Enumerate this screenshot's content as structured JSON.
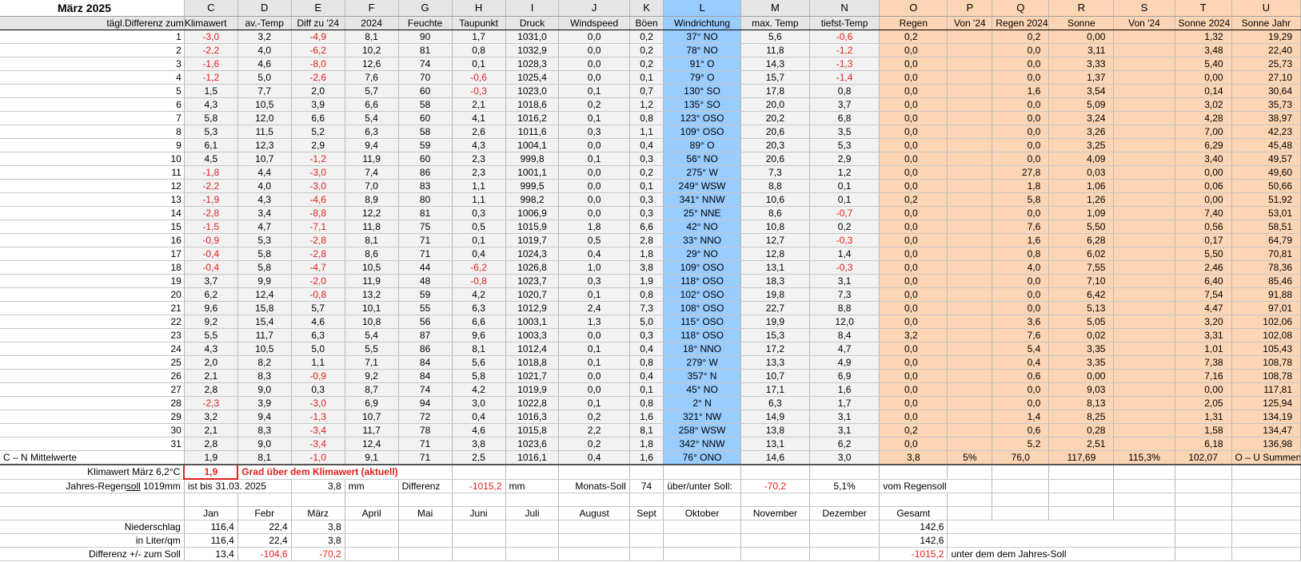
{
  "title": "März 2025",
  "columns": {
    "letters": [
      "C",
      "D",
      "E",
      "F",
      "G",
      "H",
      "I",
      "J",
      "K",
      "L",
      "M",
      "N",
      "O",
      "P",
      "Q",
      "R",
      "S",
      "T",
      "U"
    ],
    "subheader_lead": "tägl.Differenz zum",
    "names": [
      "Klimawert",
      "av.-Temp",
      "Diff zu '24",
      "2024",
      "Feuchte",
      "Taupunkt",
      "Druck",
      "Windspeed",
      "Böen",
      "Windrichtung",
      "max. Temp",
      "tiefst-Temp",
      "Regen",
      "Von '24",
      "Regen 2024",
      "Sonne",
      "Von '24",
      "Sonne 2024",
      "Sonne Jahr"
    ]
  },
  "rows": [
    [
      "1",
      "-3,0",
      "3,2",
      "-4,9",
      "8,1",
      "90",
      "1,7",
      "1031,0",
      "0,0",
      "0,2",
      "37° NO",
      "5,6",
      "-0,6",
      "0,2",
      "",
      "0,2",
      "0,00",
      "",
      "1,32",
      "19,29"
    ],
    [
      "2",
      "-2,2",
      "4,0",
      "-6,2",
      "10,2",
      "81",
      "0,8",
      "1032,9",
      "0,0",
      "0,2",
      "78° NO",
      "11,8",
      "-1,2",
      "0,0",
      "",
      "0,0",
      "3,11",
      "",
      "3,48",
      "22,40"
    ],
    [
      "3",
      "-1,6",
      "4,6",
      "-8,0",
      "12,6",
      "74",
      "0,1",
      "1028,3",
      "0,0",
      "0,2",
      "91° O",
      "14,3",
      "-1,3",
      "0,0",
      "",
      "0,0",
      "3,33",
      "",
      "5,40",
      "25,73"
    ],
    [
      "4",
      "-1,2",
      "5,0",
      "-2,6",
      "7,6",
      "70",
      "-0,6",
      "1025,4",
      "0,0",
      "0,1",
      "79° O",
      "15,7",
      "-1,4",
      "0,0",
      "",
      "0,0",
      "1,37",
      "",
      "0,00",
      "27,10"
    ],
    [
      "5",
      "1,5",
      "7,7",
      "2,0",
      "5,7",
      "60",
      "-0,3",
      "1023,0",
      "0,1",
      "0,7",
      "130° SO",
      "17,8",
      "0,8",
      "0,0",
      "",
      "1,6",
      "3,54",
      "",
      "0,14",
      "30,64"
    ],
    [
      "6",
      "4,3",
      "10,5",
      "3,9",
      "6,6",
      "58",
      "2,1",
      "1018,6",
      "0,2",
      "1,2",
      "135° SO",
      "20,0",
      "3,7",
      "0,0",
      "",
      "0,0",
      "5,09",
      "",
      "3,02",
      "35,73"
    ],
    [
      "7",
      "5,8",
      "12,0",
      "6,6",
      "5,4",
      "60",
      "4,1",
      "1016,2",
      "0,1",
      "0,8",
      "123° OSO",
      "20,2",
      "6,8",
      "0,0",
      "",
      "0,0",
      "3,24",
      "",
      "4,28",
      "38,97"
    ],
    [
      "8",
      "5,3",
      "11,5",
      "5,2",
      "6,3",
      "58",
      "2,6",
      "1011,6",
      "0,3",
      "1,1",
      "109° OSO",
      "20,6",
      "3,5",
      "0,0",
      "",
      "0,0",
      "3,26",
      "",
      "7,00",
      "42,23"
    ],
    [
      "9",
      "6,1",
      "12,3",
      "2,9",
      "9,4",
      "59",
      "4,3",
      "1004,1",
      "0,0",
      "0,4",
      "89° O",
      "20,3",
      "5,3",
      "0,0",
      "",
      "0,0",
      "3,25",
      "",
      "6,29",
      "45,48"
    ],
    [
      "10",
      "4,5",
      "10,7",
      "-1,2",
      "11,9",
      "60",
      "2,3",
      "999,8",
      "0,1",
      "0,3",
      "56° NO",
      "20,6",
      "2,9",
      "0,0",
      "",
      "0,0",
      "4,09",
      "",
      "3,40",
      "49,57"
    ],
    [
      "11",
      "-1,8",
      "4,4",
      "-3,0",
      "7,4",
      "86",
      "2,3",
      "1001,1",
      "0,0",
      "0,2",
      "275° W",
      "7,3",
      "1,2",
      "0,0",
      "",
      "27,8",
      "0,03",
      "",
      "0,00",
      "49,60"
    ],
    [
      "12",
      "-2,2",
      "4,0",
      "-3,0",
      "7,0",
      "83",
      "1,1",
      "999,5",
      "0,0",
      "0,1",
      "249° WSW",
      "8,8",
      "0,1",
      "0,0",
      "",
      "1,8",
      "1,06",
      "",
      "0,06",
      "50,66"
    ],
    [
      "13",
      "-1,9",
      "4,3",
      "-4,6",
      "8,9",
      "80",
      "1,1",
      "998,2",
      "0,0",
      "0,3",
      "341° NNW",
      "10,6",
      "0,1",
      "0,2",
      "",
      "5,8",
      "1,26",
      "",
      "0,00",
      "51,92"
    ],
    [
      "14",
      "-2,8",
      "3,4",
      "-8,8",
      "12,2",
      "81",
      "0,3",
      "1006,9",
      "0,0",
      "0,3",
      "25° NNE",
      "8,6",
      "-0,7",
      "0,0",
      "",
      "0,0",
      "1,09",
      "",
      "7,40",
      "53,01"
    ],
    [
      "15",
      "-1,5",
      "4,7",
      "-7,1",
      "11,8",
      "75",
      "0,5",
      "1015,9",
      "1,8",
      "6,6",
      "42° NO",
      "10,8",
      "0,2",
      "0,0",
      "",
      "7,6",
      "5,50",
      "",
      "0,56",
      "58,51"
    ],
    [
      "16",
      "-0,9",
      "5,3",
      "-2,8",
      "8,1",
      "71",
      "0,1",
      "1019,7",
      "0,5",
      "2,8",
      "33° NNO",
      "12,7",
      "-0,3",
      "0,0",
      "",
      "1,6",
      "6,28",
      "",
      "0,17",
      "64,79"
    ],
    [
      "17",
      "-0,4",
      "5,8",
      "-2,8",
      "8,6",
      "71",
      "0,4",
      "1024,3",
      "0,4",
      "1,8",
      "29° NO",
      "12,8",
      "1,4",
      "0,0",
      "",
      "0,8",
      "6,02",
      "",
      "5,50",
      "70,81"
    ],
    [
      "18",
      "-0,4",
      "5,8",
      "-4,7",
      "10,5",
      "44",
      "-6,2",
      "1026,8",
      "1,0",
      "3,8",
      "109° OSO",
      "13,1",
      "-0,3",
      "0,0",
      "",
      "4,0",
      "7,55",
      "",
      "2,46",
      "78,36"
    ],
    [
      "19",
      "3,7",
      "9,9",
      "-2,0",
      "11,9",
      "48",
      "-0,8",
      "1023,7",
      "0,3",
      "1,9",
      "118° OSO",
      "18,3",
      "3,1",
      "0,0",
      "",
      "0,0",
      "7,10",
      "",
      "6,40",
      "85,46"
    ],
    [
      "20",
      "6,2",
      "12,4",
      "-0,8",
      "13,2",
      "59",
      "4,2",
      "1020,7",
      "0,1",
      "0,8",
      "102° OSO",
      "19,8",
      "7,3",
      "0,0",
      "",
      "0,0",
      "6,42",
      "",
      "7,54",
      "91,88"
    ],
    [
      "21",
      "9,6",
      "15,8",
      "5,7",
      "10,1",
      "55",
      "6,3",
      "1012,9",
      "2,4",
      "7,3",
      "108° OSO",
      "22,7",
      "8,8",
      "0,0",
      "",
      "0,0",
      "5,13",
      "",
      "4,47",
      "97,01"
    ],
    [
      "22",
      "9,2",
      "15,4",
      "4,6",
      "10,8",
      "56",
      "6,6",
      "1003,1",
      "1,3",
      "5,0",
      "115° OSO",
      "19,9",
      "12,0",
      "0,0",
      "",
      "3,6",
      "5,05",
      "",
      "3,20",
      "102,06"
    ],
    [
      "23",
      "5,5",
      "11,7",
      "6,3",
      "5,4",
      "87",
      "9,6",
      "1003,3",
      "0,0",
      "0,3",
      "118° OSO",
      "15,3",
      "8,4",
      "3,2",
      "",
      "7,6",
      "0,02",
      "",
      "3,31",
      "102,08"
    ],
    [
      "24",
      "4,3",
      "10,5",
      "5,0",
      "5,5",
      "86",
      "8,1",
      "1012,4",
      "0,1",
      "0,4",
      "18° NNO",
      "17,2",
      "4,7",
      "0,0",
      "",
      "5,4",
      "3,35",
      "",
      "1,01",
      "105,43"
    ],
    [
      "25",
      "2,0",
      "8,2",
      "1,1",
      "7,1",
      "84",
      "5,6",
      "1018,8",
      "0,1",
      "0,8",
      "279° W",
      "13,3",
      "4,9",
      "0,0",
      "",
      "0,4",
      "3,35",
      "",
      "7,38",
      "108,78"
    ],
    [
      "26",
      "2,1",
      "8,3",
      "-0,9",
      "9,2",
      "84",
      "5,8",
      "1021,7",
      "0,0",
      "0,4",
      "357° N",
      "10,7",
      "6,9",
      "0,0",
      "",
      "0,6",
      "0,00",
      "",
      "7,16",
      "108,78"
    ],
    [
      "27",
      "2,8",
      "9,0",
      "0,3",
      "8,7",
      "74",
      "4,2",
      "1019,9",
      "0,0",
      "0,1",
      "45° NO",
      "17,1",
      "1,6",
      "0,0",
      "",
      "0,0",
      "9,03",
      "",
      "0,00",
      "117,81"
    ],
    [
      "28",
      "-2,3",
      "3,9",
      "-3,0",
      "6,9",
      "94",
      "3,0",
      "1022,8",
      "0,1",
      "0,8",
      "2° N",
      "6,3",
      "1,7",
      "0,0",
      "",
      "0,0",
      "8,13",
      "",
      "2,05",
      "125,94"
    ],
    [
      "29",
      "3,2",
      "9,4",
      "-1,3",
      "10,7",
      "72",
      "0,4",
      "1016,3",
      "0,2",
      "1,6",
      "321° NW",
      "14,9",
      "3,1",
      "0,0",
      "",
      "1,4",
      "8,25",
      "",
      "1,31",
      "134,19"
    ],
    [
      "30",
      "2,1",
      "8,3",
      "-3,4",
      "11,7",
      "78",
      "4,6",
      "1015,8",
      "2,2",
      "8,1",
      "258° WSW",
      "13,8",
      "3,1",
      "0,2",
      "",
      "0,6",
      "0,28",
      "",
      "1,58",
      "134,47"
    ],
    [
      "31",
      "2,8",
      "9,0",
      "-3,4",
      "12,4",
      "71",
      "3,8",
      "1023,6",
      "0,2",
      "1,8",
      "342° NNW",
      "13,1",
      "6,2",
      "0,0",
      "",
      "5,2",
      "2,51",
      "",
      "6,18",
      "136,98"
    ]
  ],
  "averages": {
    "label": "C – N Mittelwerte",
    "values": [
      "1,9",
      "8,1",
      "-1,0",
      "9,1",
      "71",
      "2,5",
      "1016,1",
      "0,4",
      "1,6",
      "76° ONO",
      "14,6",
      "3,0"
    ],
    "sums": [
      "3,8",
      "5%",
      "76,0",
      "117,69",
      "115,3%",
      "102,07"
    ],
    "sums_label": "O – U Summen"
  },
  "climate": {
    "label": "Klimawert März 6,2°C",
    "value": "1,9",
    "note": "Grad über dem Klimawert (aktuell)"
  },
  "rain_target": {
    "label_prefix": "Jahres-Regen",
    "label_underlined": "soll",
    "label_suffix": " 1019mm",
    "until": "ist bis",
    "date": "31.03. 2025",
    "amount": "3,8",
    "unit": "mm",
    "diff_label": "Differenz",
    "diff_value": "-1015,2",
    "diff_unit": "mm",
    "monthly_label": "Monats-Soll",
    "monthly_value": "74",
    "over_under_label": "über/unter Soll:",
    "over_under_value": "-70,2",
    "percent": "5,1%",
    "percent_label": "vom Regensoll"
  },
  "months": {
    "names": [
      "Jan",
      "Febr",
      "März",
      "April",
      "Mai",
      "Juni",
      "Juli",
      "August",
      "Sept",
      "Oktober",
      "November",
      "Dezember",
      "Gesamt"
    ],
    "rows": [
      {
        "label": "Niederschlag",
        "values": [
          "116,4",
          "22,4",
          "3,8",
          "",
          "",
          "",
          "",
          "",
          "",
          "",
          "",
          "",
          "142,6"
        ],
        "extra": ""
      },
      {
        "label": "in Liter/qm",
        "values": [
          "116,4",
          "22,4",
          "3,8",
          "",
          "",
          "",
          "",
          "",
          "",
          "",
          "",
          "",
          "142,6"
        ],
        "extra": ""
      },
      {
        "label": "Differenz  +/- zum Soll",
        "values": [
          "13,4",
          "-104,6",
          "-70,2",
          "",
          "",
          "",
          "",
          "",
          "",
          "",
          "",
          "",
          "-1015,2"
        ],
        "extra": "unter dem dem Jahres-Soll"
      }
    ]
  },
  "colors": {
    "orange": "#fcd5b4",
    "blue": "#99ccff",
    "gray": "#f2f2f2",
    "header_gray": "#e6e6e6",
    "negative": "#e0201c"
  }
}
